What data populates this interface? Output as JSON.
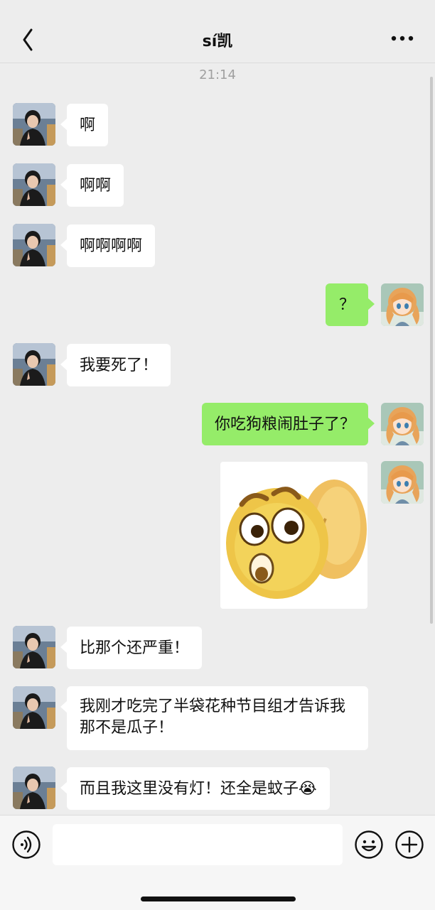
{
  "header": {
    "title": "sí凯",
    "back_icon": "chevron-left-icon",
    "more_icon": "ellipsis-icon"
  },
  "timestamp": "21:14",
  "messages": [
    {
      "side": "left",
      "text": "啊"
    },
    {
      "side": "left",
      "text": "啊啊"
    },
    {
      "side": "left",
      "text": "啊啊啊啊"
    },
    {
      "side": "right",
      "text": "？"
    },
    {
      "side": "left",
      "text": "我要死了！"
    },
    {
      "side": "right",
      "text": "你吃狗粮闹肚子了？"
    },
    {
      "side": "right",
      "type": "sticker",
      "icon": "shocked-emoji-sticker"
    },
    {
      "side": "left",
      "text": "比那个还严重！"
    },
    {
      "side": "left",
      "text": "我刚才吃完了半袋花种节目组才告诉我那不是瓜子！"
    },
    {
      "side": "left",
      "text": "而且我这里没有灯！还全是蚊子😭"
    }
  ],
  "input_bar": {
    "voice_icon": "voice-icon",
    "emoji_icon": "emoji-icon",
    "plus_icon": "plus-icon",
    "value": ""
  },
  "colors": {
    "background": "#ededed",
    "sent_bubble": "#95ec69",
    "received_bubble": "#ffffff"
  }
}
